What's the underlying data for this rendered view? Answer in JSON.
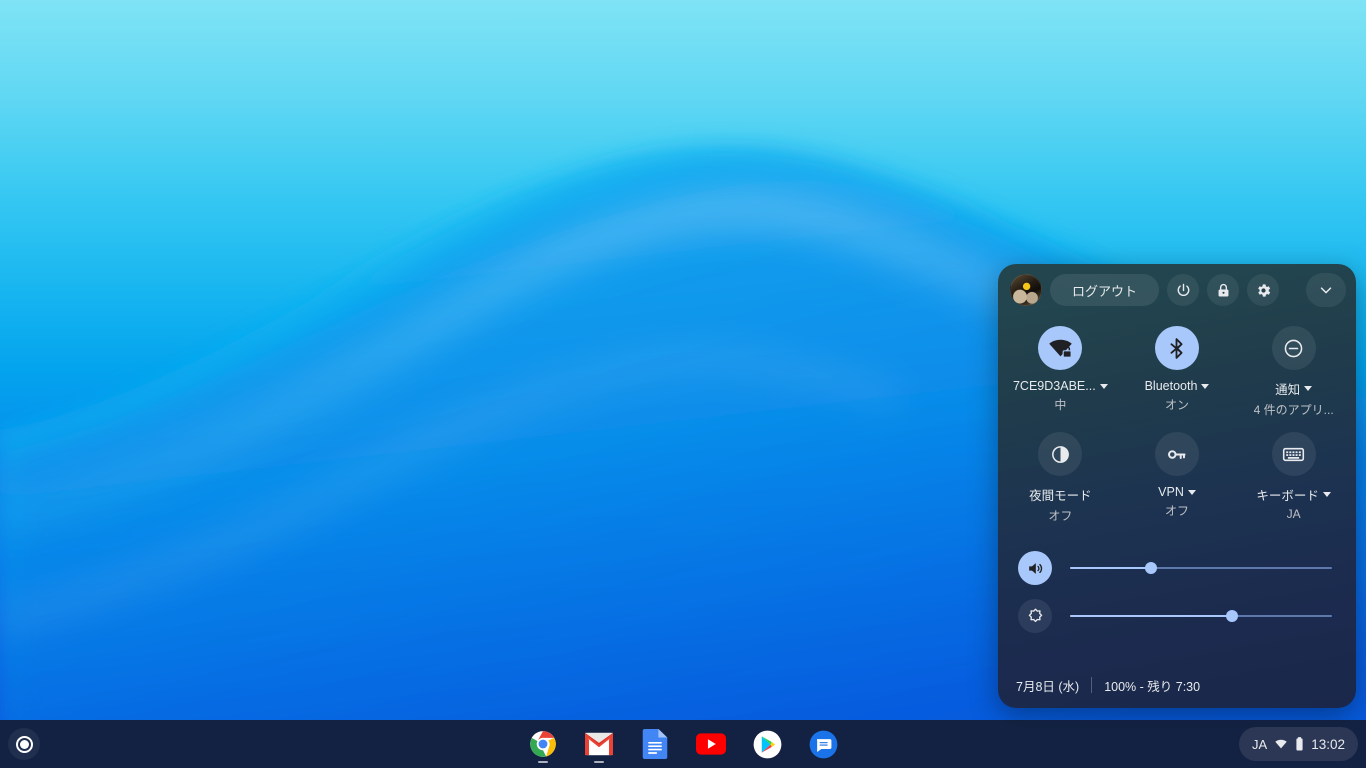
{
  "wallpaper": {
    "description": "blue gradient abstract curve wallpaper",
    "top_color": "#7fe3f5",
    "bottom_color": "#0a4ed8"
  },
  "tray": {
    "signout_label": "ログアウト",
    "icons": {
      "power": "power-icon",
      "lock": "lock-icon",
      "settings": "gear-icon",
      "collapse": "chevron-down-icon"
    },
    "pods": [
      {
        "name": "network",
        "icon": "wifi-locked-icon",
        "label": "7CE9D3ABE...",
        "sublabel": "中",
        "has_caret": true,
        "active": true
      },
      {
        "name": "bluetooth",
        "icon": "bluetooth-icon",
        "label": "Bluetooth",
        "sublabel": "オン",
        "has_caret": true,
        "active": true
      },
      {
        "name": "notifications",
        "icon": "do-not-disturb-icon",
        "label": "通知",
        "sublabel": "4 件のアプリ...",
        "has_caret": true,
        "active": false
      },
      {
        "name": "night-light",
        "icon": "night-light-icon",
        "label": "夜間モード",
        "sublabel": "オフ",
        "has_caret": false,
        "active": false
      },
      {
        "name": "vpn",
        "icon": "vpn-key-icon",
        "label": "VPN",
        "sublabel": "オフ",
        "has_caret": true,
        "active": false
      },
      {
        "name": "keyboard",
        "icon": "keyboard-icon",
        "label": "キーボード",
        "sublabel": "JA",
        "has_caret": true,
        "active": false
      }
    ],
    "sliders": [
      {
        "name": "volume",
        "icon": "volume-up-icon",
        "value": 31,
        "active": true
      },
      {
        "name": "brightness",
        "icon": "brightness-icon",
        "value": 62,
        "active": false
      }
    ],
    "footer": {
      "date": "7月8日 (水)",
      "battery": "100% - 残り 7:30"
    },
    "accent_color": "#a8c7fa"
  },
  "shelf": {
    "launcher": "launcher-icon",
    "apps": [
      {
        "name": "chrome",
        "label": "Google Chrome",
        "running": true
      },
      {
        "name": "gmail",
        "label": "Gmail",
        "running": true
      },
      {
        "name": "docs",
        "label": "Google Docs",
        "running": false
      },
      {
        "name": "youtube",
        "label": "YouTube",
        "running": false
      },
      {
        "name": "play-store",
        "label": "Play ストア",
        "running": false
      },
      {
        "name": "messages",
        "label": "メッセージ",
        "running": false
      }
    ],
    "status": {
      "language": "JA",
      "network_icon": "wifi-icon",
      "battery_icon": "battery-full-icon",
      "clock": "13:02"
    }
  }
}
